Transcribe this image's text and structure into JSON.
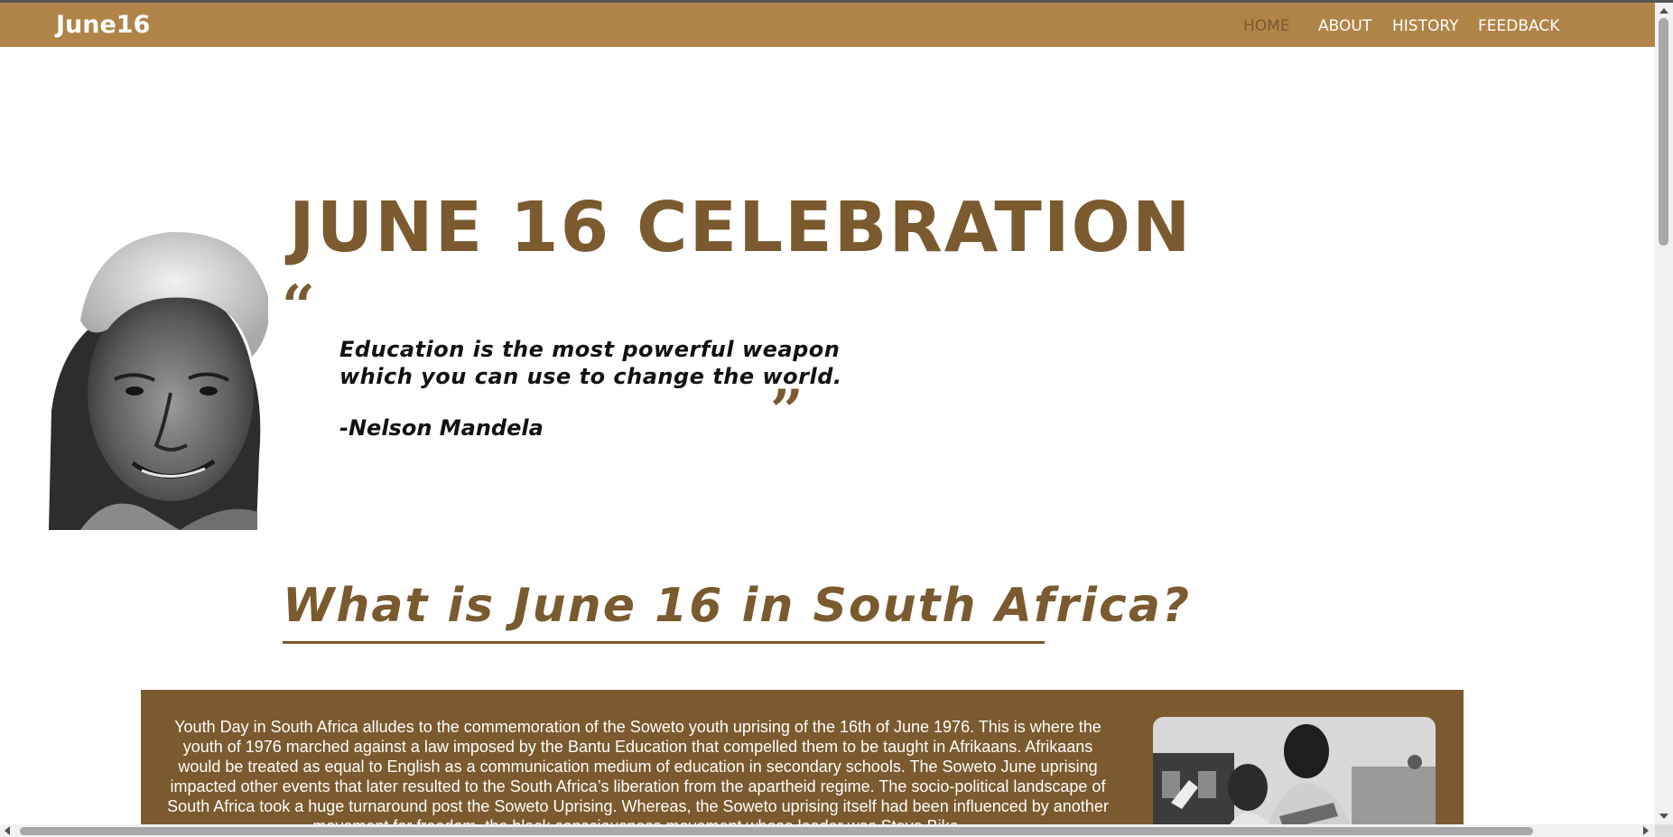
{
  "nav": {
    "brand": "June16",
    "links": [
      "HOME",
      "ABOUT",
      "HISTORY",
      "FEEDBACK"
    ],
    "active": "HOME"
  },
  "hero": {
    "title": "JUNE 16 CELEBRATION",
    "quote_open": "“",
    "quote_close": "”",
    "quote": "Education is the most powerful weapon which you can use to change the world.",
    "author": "-Nelson Mandela"
  },
  "section": {
    "heading": "What is June 16 in South Africa?",
    "body": "Youth Day in South Africa alludes to the commemoration of the Soweto youth uprising of the 16th of June 1976. This is where the youth of 1976 marched against a law imposed by the Bantu Education that compelled them to be taught in Afrikaans. Afrikaans would be treated as equal to English as a communication medium of education in secondary schools. The Soweto June uprising impacted other events that later resulted to the South Africa’s liberation from the apartheid regime. The socio-political landscape of South Africa took a huge turnaround post the Soweto Uprising. Whereas, the Soweto uprising itself had been influenced by another movement for freedom, the black consciousness movement whose leader was Steve Biko."
  },
  "colors": {
    "nav_bg": "#b08448",
    "accent": "#7a5a2e",
    "active_link": "#7a5a2e",
    "text_dark": "#111111"
  },
  "icons": {
    "portrait": "nelson-mandela-photo",
    "section_photo": "soweto-uprising-photo"
  }
}
